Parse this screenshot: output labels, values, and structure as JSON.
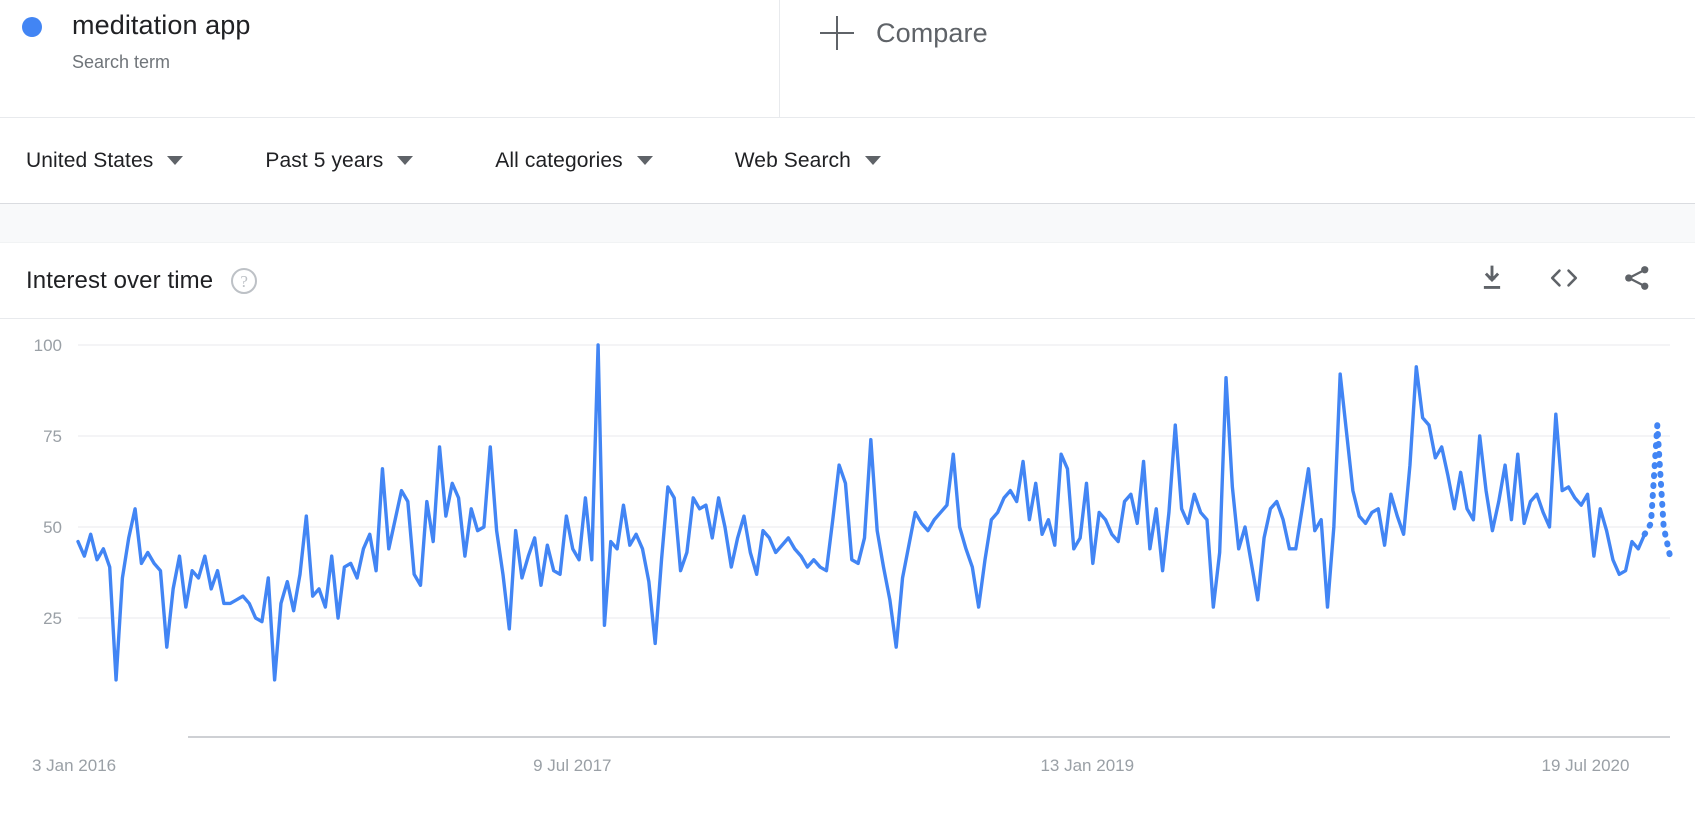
{
  "search_term": {
    "name": "meditation app",
    "type_label": "Search term",
    "dot_color": "#4285F4"
  },
  "compare": {
    "label": "Compare",
    "icon": "plus-icon"
  },
  "filters": [
    {
      "label": "United States",
      "icon": "chevron-down-icon"
    },
    {
      "label": "Past 5 years",
      "icon": "chevron-down-icon"
    },
    {
      "label": "All categories",
      "icon": "chevron-down-icon"
    },
    {
      "label": "Web Search",
      "icon": "chevron-down-icon"
    }
  ],
  "card": {
    "title": "Interest over time",
    "help_icon": "help-circle-icon",
    "help_glyph": "?",
    "actions": [
      {
        "name": "download-icon",
        "title": "Download CSV"
      },
      {
        "name": "embed-code-icon",
        "title": "Embed"
      },
      {
        "name": "share-icon",
        "title": "Share"
      }
    ]
  },
  "chart_data": {
    "type": "line",
    "title": "Interest over time",
    "xlabel": "",
    "ylabel": "",
    "ylim": [
      0,
      100
    ],
    "y_ticks": [
      25,
      50,
      75,
      100
    ],
    "grid": true,
    "legend": false,
    "line_color": "#4285F4",
    "x_tick_labels": [
      "3 Jan 2016",
      "9 Jul 2017",
      "13 Jan 2019",
      "19 Jul 2020"
    ],
    "x_tick_positions": [
      0,
      79,
      159,
      238
    ],
    "x_start": "3 Jan 2016",
    "x_end": "2021",
    "x_interval": "weekly",
    "partial_data_tail_points": 4,
    "series": [
      {
        "name": "meditation app",
        "values": [
          46,
          42,
          48,
          41,
          44,
          39,
          8,
          36,
          47,
          55,
          40,
          43,
          40,
          38,
          17,
          33,
          42,
          28,
          38,
          36,
          42,
          33,
          38,
          29,
          29,
          30,
          31,
          29,
          25,
          24,
          36,
          8,
          29,
          35,
          27,
          37,
          53,
          31,
          33,
          28,
          42,
          25,
          39,
          40,
          36,
          44,
          48,
          38,
          66,
          44,
          52,
          60,
          57,
          37,
          34,
          57,
          46,
          72,
          53,
          62,
          58,
          42,
          55,
          49,
          50,
          72,
          49,
          37,
          22,
          49,
          36,
          42,
          47,
          34,
          45,
          38,
          37,
          53,
          44,
          41,
          58,
          41,
          100,
          23,
          46,
          44,
          56,
          45,
          48,
          44,
          35,
          18,
          41,
          61,
          58,
          38,
          43,
          58,
          55,
          56,
          47,
          58,
          50,
          39,
          47,
          53,
          43,
          37,
          49,
          47,
          43,
          45,
          47,
          44,
          42,
          39,
          41,
          39,
          38,
          52,
          67,
          62,
          41,
          40,
          47,
          74,
          49,
          39,
          30,
          17,
          36,
          45,
          54,
          51,
          49,
          52,
          54,
          56,
          70,
          50,
          44,
          39,
          28,
          41,
          52,
          54,
          58,
          60,
          57,
          68,
          52,
          62,
          48,
          52,
          45,
          70,
          66,
          44,
          47,
          62,
          40,
          54,
          52,
          48,
          46,
          57,
          59,
          51,
          68,
          44,
          55,
          38,
          54,
          78,
          55,
          51,
          59,
          54,
          52,
          28,
          43,
          91,
          61,
          44,
          50,
          40,
          30,
          47,
          55,
          57,
          52,
          44,
          44,
          55,
          66,
          49,
          52,
          28,
          50,
          92,
          76,
          60,
          53,
          51,
          54,
          55,
          45,
          59,
          53,
          48,
          67,
          94,
          80,
          78,
          69,
          72,
          64,
          55,
          65,
          55,
          52,
          75,
          60,
          49,
          57,
          67,
          52,
          70,
          51,
          57,
          59,
          54,
          50,
          81,
          60,
          61,
          58,
          56,
          59,
          42,
          55,
          49,
          41,
          37,
          38,
          46,
          44,
          48,
          51,
          78,
          50,
          42
        ]
      }
    ]
  }
}
